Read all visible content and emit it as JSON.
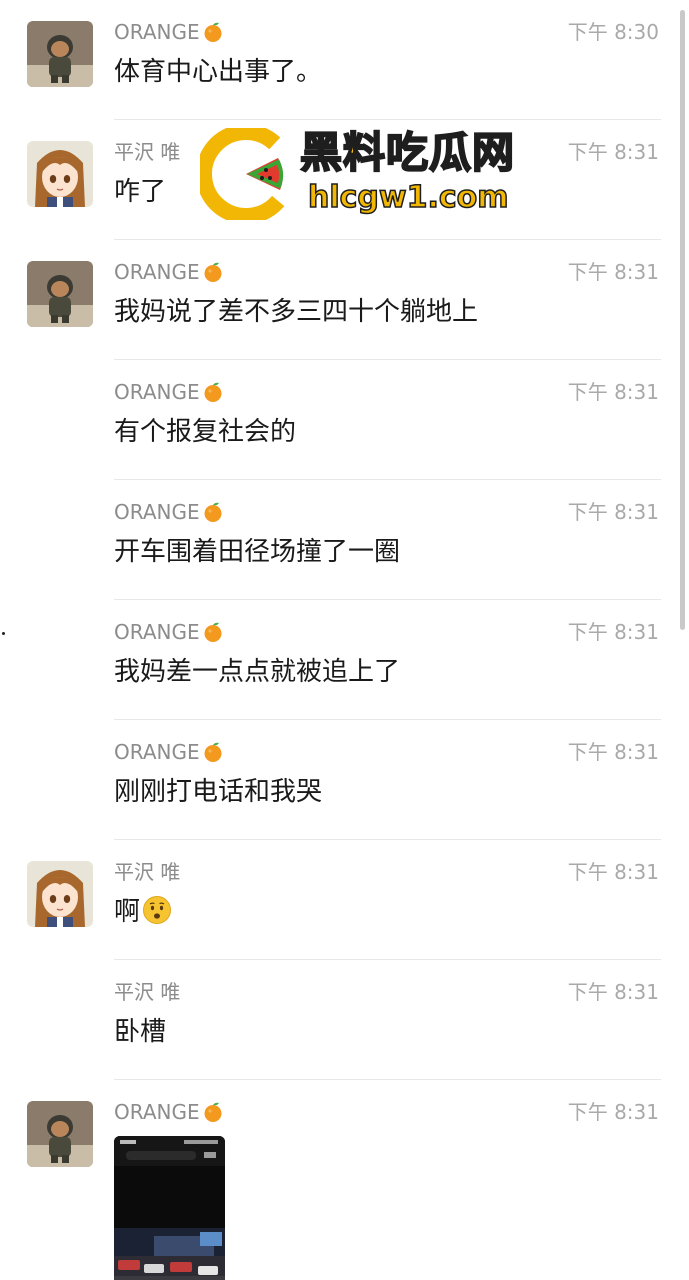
{
  "messages": [
    {
      "sender": "ORANGE",
      "sender_emoji": "orange-emoji",
      "time": "下午 8:30",
      "text": "体育中心出事了。"
    },
    {
      "sender": "平沢 唯",
      "time": "下午 8:31",
      "text": "咋了"
    },
    {
      "sender": "ORANGE",
      "sender_emoji": "orange-emoji",
      "time": "下午 8:31",
      "text": "我妈说了差不多三四十个躺地上"
    },
    {
      "sender": "ORANGE",
      "sender_emoji": "orange-emoji",
      "time": "下午 8:31",
      "text": "有个报复社会的"
    },
    {
      "sender": "ORANGE",
      "sender_emoji": "orange-emoji",
      "time": "下午 8:31",
      "text": "开车围着田径场撞了一圈"
    },
    {
      "sender": "ORANGE",
      "sender_emoji": "orange-emoji",
      "time": "下午 8:31",
      "text": "我妈差一点点就被追上了"
    },
    {
      "sender": "ORANGE",
      "sender_emoji": "orange-emoji",
      "time": "下午 8:31",
      "text": "刚刚打电话和我哭"
    },
    {
      "sender": "平沢 唯",
      "time": "下午 8:31",
      "text": "啊",
      "text_emoji": "worried-face-emoji"
    },
    {
      "sender": "平沢 唯",
      "time": "下午 8:31",
      "text": "卧槽"
    },
    {
      "sender": "ORANGE",
      "sender_emoji": "orange-emoji",
      "time": "下午 8:31",
      "attachment": "image"
    }
  ],
  "watermark": {
    "title": "黑料吃瓜网",
    "url": "hlcgw1.com"
  },
  "colors": {
    "name": "#8c8c8c",
    "time": "#a9a9a9",
    "text": "#1a1a1a",
    "divider": "#e8e8e8",
    "watermark_yellow": "#f2b705",
    "watermark_red": "#e23b2e",
    "watermark_green": "#3aa635"
  }
}
